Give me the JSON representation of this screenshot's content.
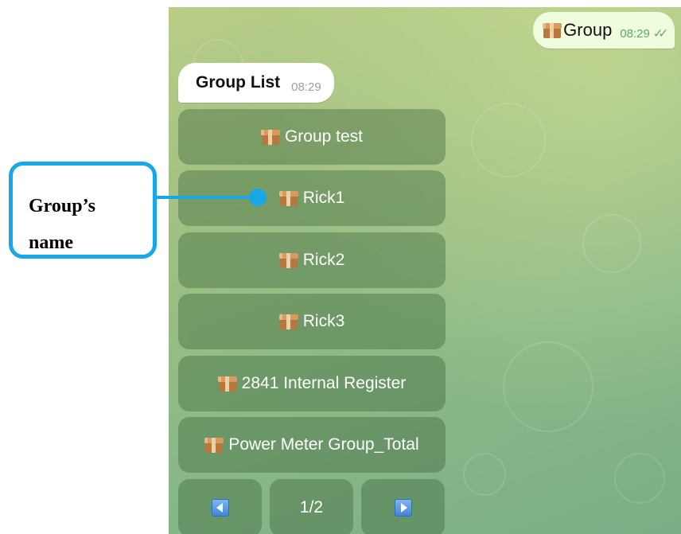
{
  "chat": {
    "outgoing": {
      "text": "Group",
      "time": "08:29",
      "status_icon": "double-check-icon",
      "emoji": "package"
    },
    "incoming": {
      "text": "Group List",
      "time": "08:29"
    },
    "keyboard": {
      "buttons": [
        {
          "label": "Group test",
          "emoji": "package"
        },
        {
          "label": "Rick1",
          "emoji": "package"
        },
        {
          "label": "Rick2",
          "emoji": "package"
        },
        {
          "label": "Rick3",
          "emoji": "package"
        },
        {
          "label": "2841 Internal Register",
          "emoji": "package"
        },
        {
          "label": "Power Meter Group_Total",
          "emoji": "package"
        }
      ],
      "nav": {
        "prev_icon": "left-arrow-icon",
        "page": "1/2",
        "next_icon": "right-arrow-icon"
      }
    }
  },
  "annotation": {
    "line1": "Group’s",
    "line2": "name",
    "color": "#1aa7e8"
  }
}
